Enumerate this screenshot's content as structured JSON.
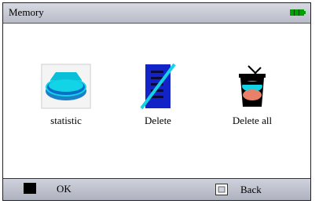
{
  "header": {
    "title": "Memory",
    "battery_icon": "battery-icon",
    "battery_color": "#00a000"
  },
  "menu": {
    "items": [
      {
        "label": "statistic",
        "icon": "statistic-icon"
      },
      {
        "label": "Delete",
        "icon": "delete-icon"
      },
      {
        "label": "Delete all",
        "icon": "delete-all-icon"
      }
    ]
  },
  "footer": {
    "ok_label": "OK",
    "back_label": "Back"
  },
  "colors": {
    "accent_cyan": "#12d4e6",
    "accent_blue": "#1224c8",
    "bar_gray": "#c0c3ce"
  }
}
